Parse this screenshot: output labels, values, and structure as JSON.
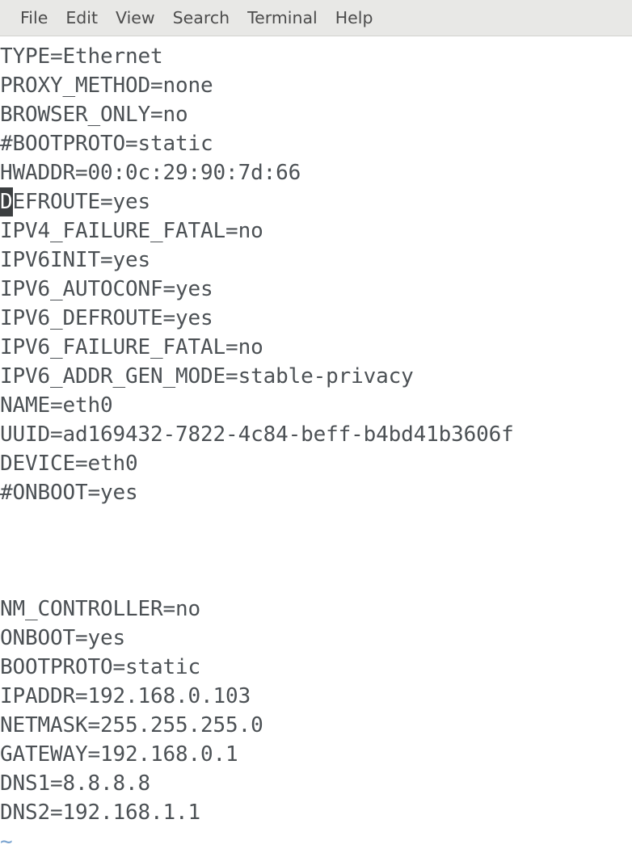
{
  "window": {
    "title": "Terminal",
    "app": "gnome-terminal"
  },
  "menubar": {
    "items": [
      {
        "label": "File"
      },
      {
        "label": "Edit"
      },
      {
        "label": "View"
      },
      {
        "label": "Search"
      },
      {
        "label": "Terminal"
      },
      {
        "label": "Help"
      }
    ]
  },
  "editor": {
    "mode": "vim-normal",
    "cursor": {
      "line": 6,
      "column": 1,
      "char": "D"
    },
    "colors": {
      "background": "#ffffff",
      "foreground": "#4c5155",
      "cursor_bg": "#3c3f41",
      "cursor_fg": "#ffffff",
      "tilde": "#7aa4d0",
      "menubar_bg": "#e8e8e6"
    },
    "lines": [
      {
        "text": "TYPE=Ethernet"
      },
      {
        "text": "PROXY_METHOD=none"
      },
      {
        "text": "BROWSER_ONLY=no"
      },
      {
        "text": "#BOOTPROTO=static"
      },
      {
        "text": "HWADDR=00:0c:29:90:7d:66"
      },
      {
        "text": "DEFROUTE=yes",
        "cursor_head": "D",
        "cursor_tail": "EFROUTE=yes"
      },
      {
        "text": "IPV4_FAILURE_FATAL=no"
      },
      {
        "text": "IPV6INIT=yes"
      },
      {
        "text": "IPV6_AUTOCONF=yes"
      },
      {
        "text": "IPV6_DEFROUTE=yes"
      },
      {
        "text": "IPV6_FAILURE_FATAL=no"
      },
      {
        "text": "IPV6_ADDR_GEN_MODE=stable-privacy"
      },
      {
        "text": "NAME=eth0"
      },
      {
        "text": "UUID=ad169432-7822-4c84-beff-b4bd41b3606f"
      },
      {
        "text": "DEVICE=eth0"
      },
      {
        "text": "#ONBOOT=yes"
      },
      {
        "text": ""
      },
      {
        "text": ""
      },
      {
        "text": ""
      },
      {
        "text": "NM_CONTROLLER=no"
      },
      {
        "text": "ONBOOT=yes"
      },
      {
        "text": "BOOTPROTO=static"
      },
      {
        "text": "IPADDR=192.168.0.103"
      },
      {
        "text": "NETMASK=255.255.255.0"
      },
      {
        "text": "GATEWAY=192.168.0.1"
      },
      {
        "text": "DNS1=8.8.8.8"
      },
      {
        "text": "DNS2=192.168.1.1"
      },
      {
        "text": "~",
        "is_tilde": true
      }
    ]
  }
}
